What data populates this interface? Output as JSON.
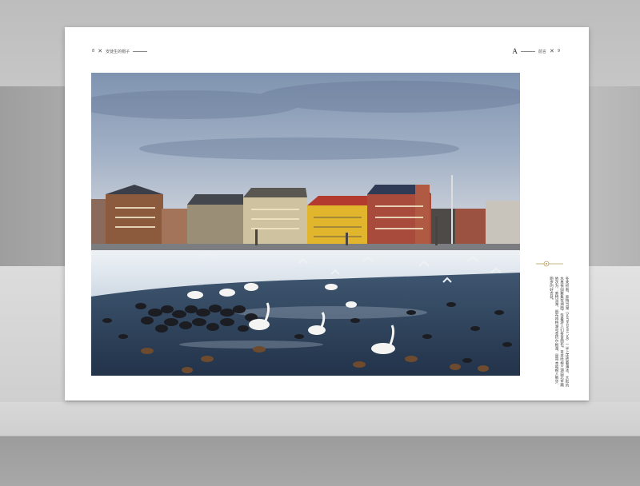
{
  "header": {
    "left_page_number": "8",
    "left_separator": "✕",
    "left_title": "安徒生的帽子",
    "right_letter": "A",
    "right_title": "前言",
    "right_separator": "✕",
    "right_page_number": "9"
  },
  "photo": {
    "subject": "winter-lake-swans-ducks-copenhagen"
  },
  "caption": {
    "text": "冬末初春，索特当湖（Sortedams Sø）一半上还结着薄冰，大批的水禽依旧聚集在湖面，等着游人们投食面包。哥本哈根三湖由北至南依次为：索特当湖、佩布林格湖与圣约尔根湖，是哥本哈根人散步、跑步的好去处。"
  },
  "colors": {
    "sky": "#8d9fb8",
    "water": "#2e4258",
    "ice": "#dfe6ee",
    "page": "#ffffff",
    "ornament": "#b89a5a"
  }
}
